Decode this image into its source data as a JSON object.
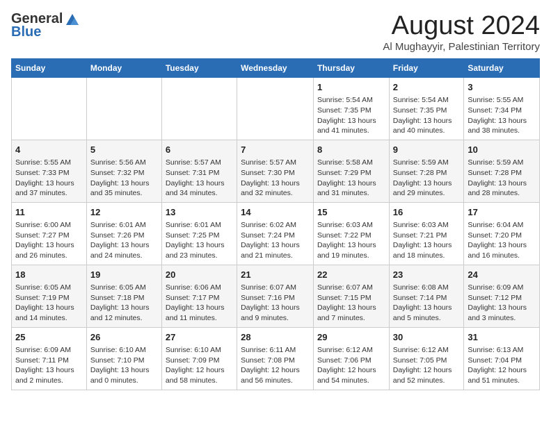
{
  "logo": {
    "general": "General",
    "blue": "Blue"
  },
  "title": "August 2024",
  "subtitle": "Al Mughayyir, Palestinian Territory",
  "headers": [
    "Sunday",
    "Monday",
    "Tuesday",
    "Wednesday",
    "Thursday",
    "Friday",
    "Saturday"
  ],
  "weeks": [
    [
      {
        "day": "",
        "info": ""
      },
      {
        "day": "",
        "info": ""
      },
      {
        "day": "",
        "info": ""
      },
      {
        "day": "",
        "info": ""
      },
      {
        "day": "1",
        "info": "Sunrise: 5:54 AM\nSunset: 7:35 PM\nDaylight: 13 hours\nand 41 minutes."
      },
      {
        "day": "2",
        "info": "Sunrise: 5:54 AM\nSunset: 7:35 PM\nDaylight: 13 hours\nand 40 minutes."
      },
      {
        "day": "3",
        "info": "Sunrise: 5:55 AM\nSunset: 7:34 PM\nDaylight: 13 hours\nand 38 minutes."
      }
    ],
    [
      {
        "day": "4",
        "info": "Sunrise: 5:55 AM\nSunset: 7:33 PM\nDaylight: 13 hours\nand 37 minutes."
      },
      {
        "day": "5",
        "info": "Sunrise: 5:56 AM\nSunset: 7:32 PM\nDaylight: 13 hours\nand 35 minutes."
      },
      {
        "day": "6",
        "info": "Sunrise: 5:57 AM\nSunset: 7:31 PM\nDaylight: 13 hours\nand 34 minutes."
      },
      {
        "day": "7",
        "info": "Sunrise: 5:57 AM\nSunset: 7:30 PM\nDaylight: 13 hours\nand 32 minutes."
      },
      {
        "day": "8",
        "info": "Sunrise: 5:58 AM\nSunset: 7:29 PM\nDaylight: 13 hours\nand 31 minutes."
      },
      {
        "day": "9",
        "info": "Sunrise: 5:59 AM\nSunset: 7:28 PM\nDaylight: 13 hours\nand 29 minutes."
      },
      {
        "day": "10",
        "info": "Sunrise: 5:59 AM\nSunset: 7:28 PM\nDaylight: 13 hours\nand 28 minutes."
      }
    ],
    [
      {
        "day": "11",
        "info": "Sunrise: 6:00 AM\nSunset: 7:27 PM\nDaylight: 13 hours\nand 26 minutes."
      },
      {
        "day": "12",
        "info": "Sunrise: 6:01 AM\nSunset: 7:26 PM\nDaylight: 13 hours\nand 24 minutes."
      },
      {
        "day": "13",
        "info": "Sunrise: 6:01 AM\nSunset: 7:25 PM\nDaylight: 13 hours\nand 23 minutes."
      },
      {
        "day": "14",
        "info": "Sunrise: 6:02 AM\nSunset: 7:24 PM\nDaylight: 13 hours\nand 21 minutes."
      },
      {
        "day": "15",
        "info": "Sunrise: 6:03 AM\nSunset: 7:22 PM\nDaylight: 13 hours\nand 19 minutes."
      },
      {
        "day": "16",
        "info": "Sunrise: 6:03 AM\nSunset: 7:21 PM\nDaylight: 13 hours\nand 18 minutes."
      },
      {
        "day": "17",
        "info": "Sunrise: 6:04 AM\nSunset: 7:20 PM\nDaylight: 13 hours\nand 16 minutes."
      }
    ],
    [
      {
        "day": "18",
        "info": "Sunrise: 6:05 AM\nSunset: 7:19 PM\nDaylight: 13 hours\nand 14 minutes."
      },
      {
        "day": "19",
        "info": "Sunrise: 6:05 AM\nSunset: 7:18 PM\nDaylight: 13 hours\nand 12 minutes."
      },
      {
        "day": "20",
        "info": "Sunrise: 6:06 AM\nSunset: 7:17 PM\nDaylight: 13 hours\nand 11 minutes."
      },
      {
        "day": "21",
        "info": "Sunrise: 6:07 AM\nSunset: 7:16 PM\nDaylight: 13 hours\nand 9 minutes."
      },
      {
        "day": "22",
        "info": "Sunrise: 6:07 AM\nSunset: 7:15 PM\nDaylight: 13 hours\nand 7 minutes."
      },
      {
        "day": "23",
        "info": "Sunrise: 6:08 AM\nSunset: 7:14 PM\nDaylight: 13 hours\nand 5 minutes."
      },
      {
        "day": "24",
        "info": "Sunrise: 6:09 AM\nSunset: 7:12 PM\nDaylight: 13 hours\nand 3 minutes."
      }
    ],
    [
      {
        "day": "25",
        "info": "Sunrise: 6:09 AM\nSunset: 7:11 PM\nDaylight: 13 hours\nand 2 minutes."
      },
      {
        "day": "26",
        "info": "Sunrise: 6:10 AM\nSunset: 7:10 PM\nDaylight: 13 hours\nand 0 minutes."
      },
      {
        "day": "27",
        "info": "Sunrise: 6:10 AM\nSunset: 7:09 PM\nDaylight: 12 hours\nand 58 minutes."
      },
      {
        "day": "28",
        "info": "Sunrise: 6:11 AM\nSunset: 7:08 PM\nDaylight: 12 hours\nand 56 minutes."
      },
      {
        "day": "29",
        "info": "Sunrise: 6:12 AM\nSunset: 7:06 PM\nDaylight: 12 hours\nand 54 minutes."
      },
      {
        "day": "30",
        "info": "Sunrise: 6:12 AM\nSunset: 7:05 PM\nDaylight: 12 hours\nand 52 minutes."
      },
      {
        "day": "31",
        "info": "Sunrise: 6:13 AM\nSunset: 7:04 PM\nDaylight: 12 hours\nand 51 minutes."
      }
    ]
  ]
}
